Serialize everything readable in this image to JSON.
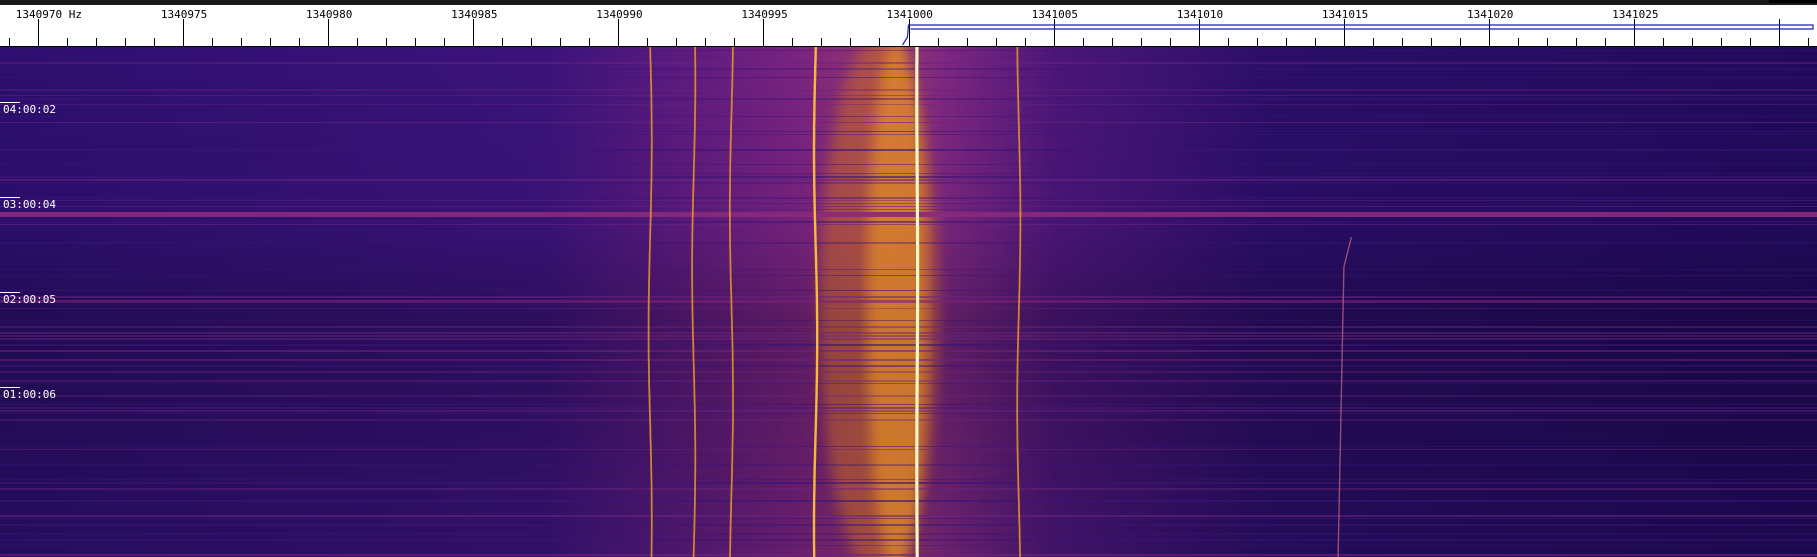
{
  "frequency_scale": {
    "unit": "Hz",
    "start_hz": 1340968.7,
    "end_hz": 1341031.3,
    "major_step_hz": 5,
    "minor_step_hz": 1,
    "major_labels": [
      {
        "hz": 1340970,
        "text": "1340970 Hz"
      },
      {
        "hz": 1340975,
        "text": "1340975"
      },
      {
        "hz": 1340980,
        "text": "1340980"
      },
      {
        "hz": 1340985,
        "text": "1340985"
      },
      {
        "hz": 1340990,
        "text": "1340990"
      },
      {
        "hz": 1340995,
        "text": "1340995"
      },
      {
        "hz": 1341000,
        "text": "1341000"
      },
      {
        "hz": 1341005,
        "text": "1341005"
      },
      {
        "hz": 1341010,
        "text": "1341010"
      },
      {
        "hz": 1341015,
        "text": "1341015"
      },
      {
        "hz": 1341020,
        "text": "1341020"
      },
      {
        "hz": 1341025,
        "text": "1341025"
      }
    ]
  },
  "time_labels": [
    {
      "text": "04:00:02"
    },
    {
      "text": "03:00:04"
    },
    {
      "text": "02:00:05"
    },
    {
      "text": "01:00:06"
    }
  ],
  "colors": {
    "waterfall_background": "#230b62",
    "signal_peak": "#ffe27a",
    "signal_mid": "#f5a30c",
    "noise_band": "#8b2a7a",
    "scale_background": "#ffffff",
    "marker_line": "#1d1dbe"
  },
  "signal_traces": [
    {
      "name": "carrier-1340991",
      "hz": 1340991.1,
      "strength": "medium"
    },
    {
      "name": "carrier-1340992",
      "hz": 1340992.6,
      "strength": "medium"
    },
    {
      "name": "carrier-1340994",
      "hz": 1340993.9,
      "strength": "medium"
    },
    {
      "name": "carrier-1340998",
      "hz": 1340996.8,
      "strength": "strong"
    },
    {
      "name": "carrier-1341000",
      "hz": 1341000.3,
      "strength": "peak"
    },
    {
      "name": "carrier-1341004",
      "hz": 1341003.8,
      "strength": "medium"
    },
    {
      "name": "drift-1341015",
      "hz": 1341015.0,
      "strength": "weak"
    }
  ]
}
